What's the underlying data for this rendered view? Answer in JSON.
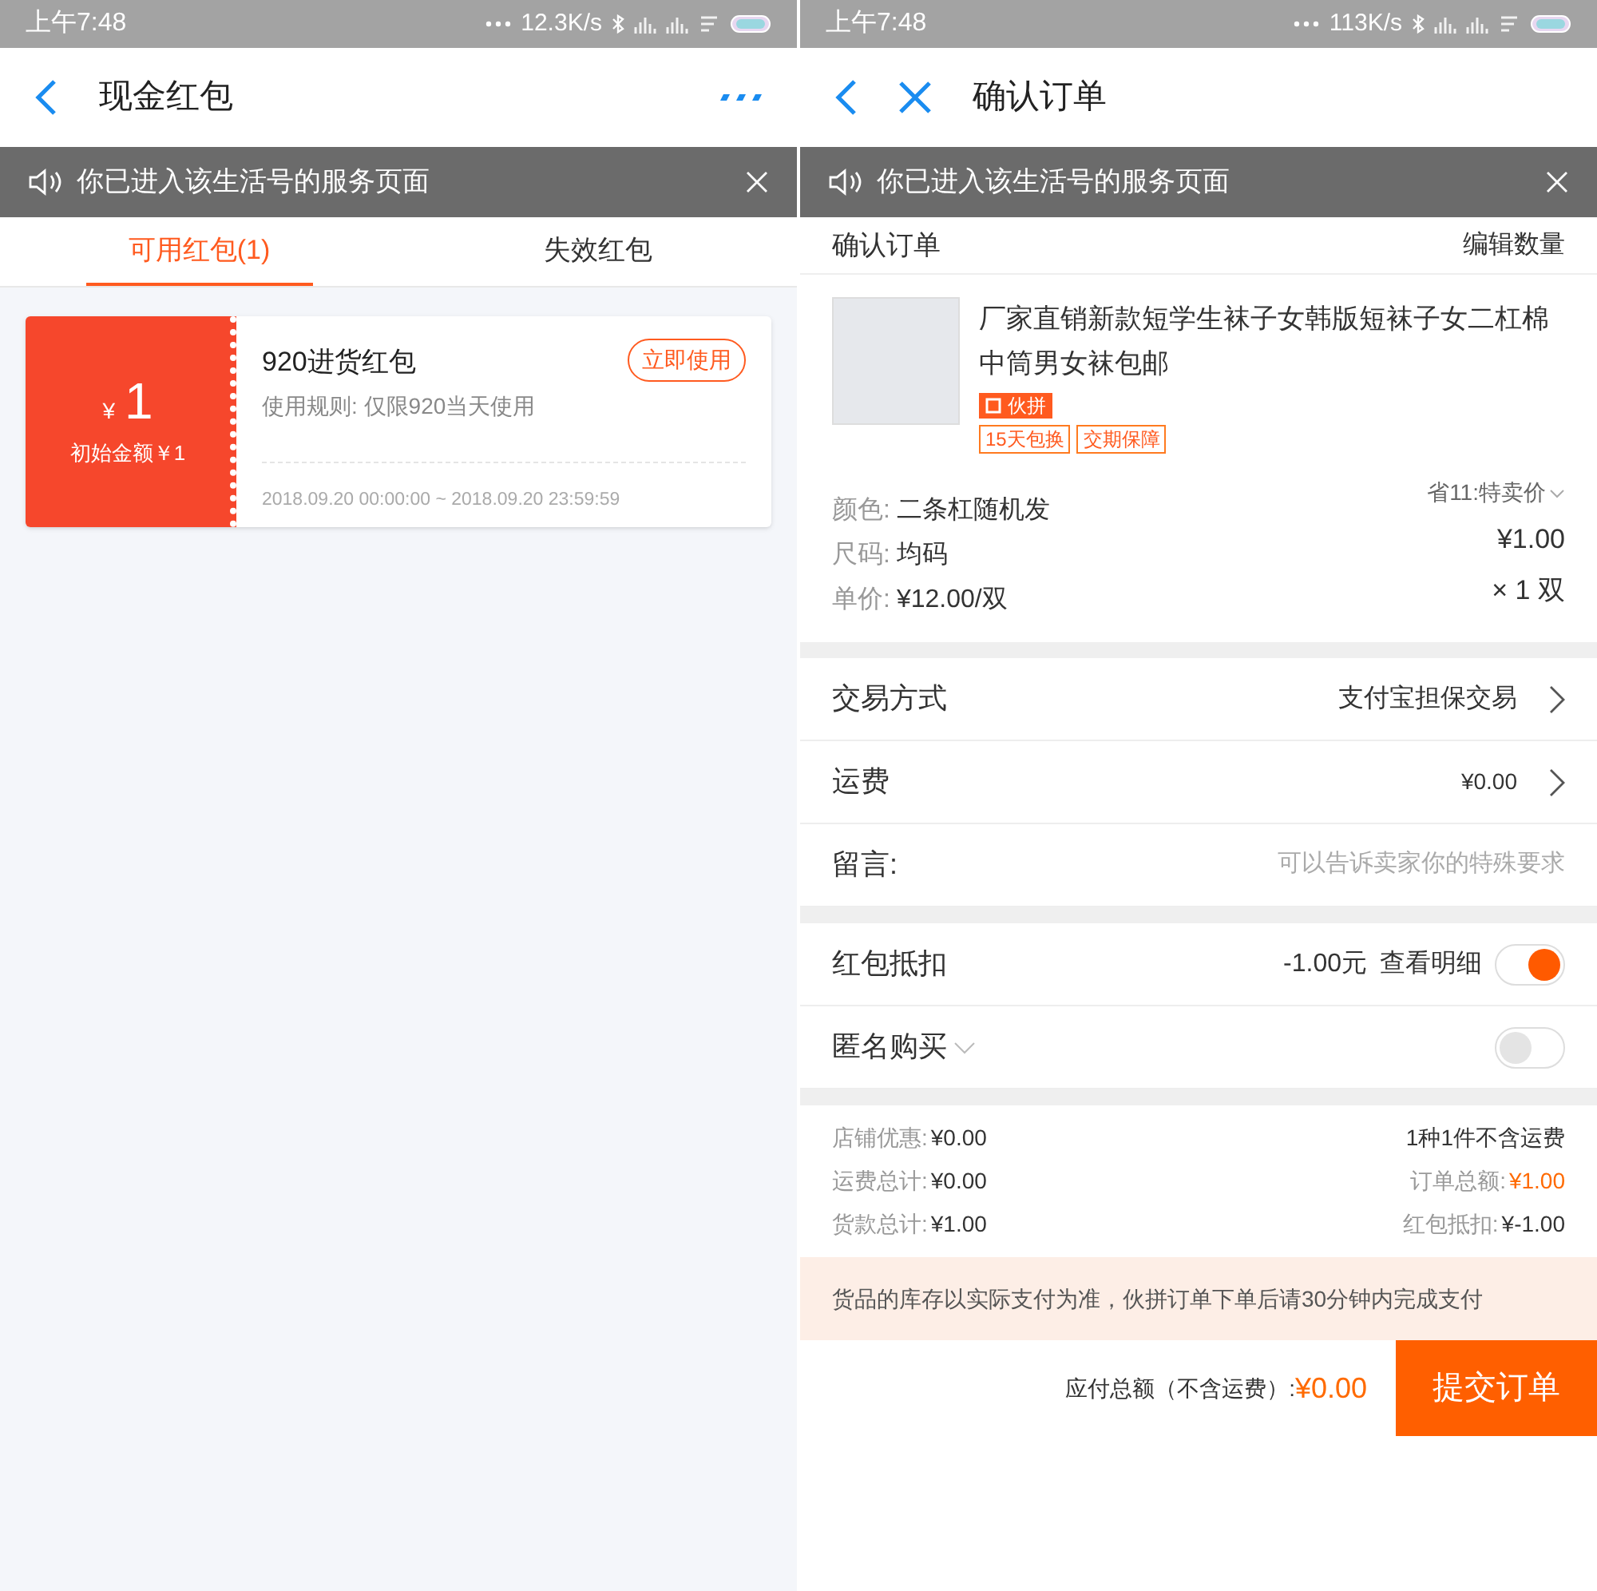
{
  "left_screen": {
    "status_bar": {
      "time": "上午7:48",
      "network_speed": "12.3K/s"
    },
    "header": {
      "title": "现金红包"
    },
    "notice": {
      "text": "你已进入该生活号的服务页面"
    },
    "tabs": [
      {
        "label": "可用红包(1)",
        "selected": true
      },
      {
        "label": "失效红包",
        "selected": false
      }
    ],
    "coupons": [
      {
        "currency": "¥",
        "amount": "1",
        "initial": "初始金额￥1",
        "title": "920进货红包",
        "rule": "使用规则: 仅限920当天使用",
        "button": "立即使用",
        "validity": "2018.09.20 00:00:00 ~ 2018.09.20 23:59:59"
      }
    ]
  },
  "right_screen": {
    "status_bar": {
      "time": "上午7:48",
      "network_speed": "113K/s"
    },
    "header": {
      "title": "确认订单"
    },
    "notice": {
      "text": "你已进入该生活号的服务页面"
    },
    "order_header": {
      "title": "确认订单",
      "action": "编辑数量"
    },
    "product": {
      "title": "厂家直销新款短学生袜子女韩版短袜子女二杠棉中筒男女袜包邮",
      "group_badge": "伙拼",
      "tags": [
        "15天包换",
        "交期保障"
      ],
      "specs": [
        {
          "label": "颜色:",
          "value": "二条杠随机发"
        },
        {
          "label": "尺码:",
          "value": "均码"
        },
        {
          "label": "单价:",
          "value": "¥12.00/双"
        }
      ],
      "price_note": "省11:特卖价",
      "price": "¥1.00",
      "quantity": "× 1 双"
    },
    "rows": [
      {
        "kind": "link",
        "label": "交易方式",
        "value": "支付宝担保交易"
      },
      {
        "kind": "link",
        "label": "运费",
        "value": "¥0.00"
      },
      {
        "kind": "input",
        "label": "留言:",
        "placeholder": "可以告诉卖家你的特殊要求"
      }
    ],
    "toggles": [
      {
        "label": "红包抵扣",
        "value": "-1.00元",
        "link": "查看明细",
        "dropdown": false,
        "on": true
      },
      {
        "label": "匿名购买",
        "dropdown": true,
        "on": false
      }
    ],
    "summary_left": [
      {
        "label": "店铺优惠:",
        "value": "¥0.00"
      },
      {
        "label": "运费总计:",
        "value": "¥0.00"
      },
      {
        "label": "货款总计:",
        "value": "¥1.00"
      }
    ],
    "summary_right": [
      {
        "kind": "text",
        "text": "1种1件不含运费"
      },
      {
        "kind": "pair",
        "label": "订单总额:",
        "value": "¥1.00",
        "highlight": true
      },
      {
        "kind": "pair",
        "label": "红包抵扣:",
        "value": "¥-1.00",
        "highlight": false
      }
    ],
    "stock_notice": "货品的库存以实际支付为准，伙拼订单下单后请30分钟内完成支付",
    "footer": {
      "label": "应付总额（不含运费）:",
      "amount": "¥0.00",
      "button": "提交订单"
    }
  }
}
